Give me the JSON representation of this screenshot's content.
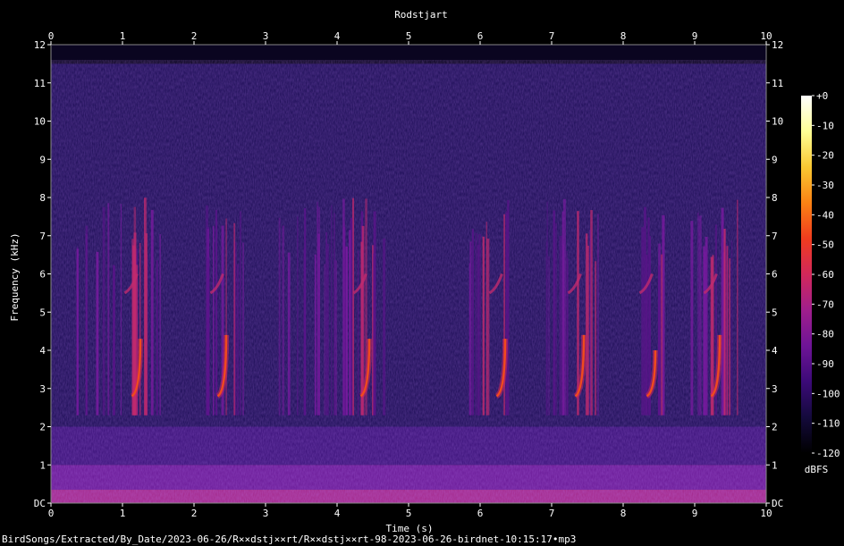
{
  "chart_data": {
    "type": "heatmap",
    "title": "Rodstjart",
    "xlabel": "Time (s)",
    "ylabel": "Frequency (kHz)",
    "xlim": [
      0,
      10
    ],
    "ylim": [
      0,
      12
    ],
    "x_ticks": [
      "0",
      "1",
      "2",
      "3",
      "4",
      "5",
      "6",
      "7",
      "8",
      "9",
      "10"
    ],
    "y_ticks": [
      "DC",
      "1",
      "2",
      "3",
      "4",
      "5",
      "6",
      "7",
      "8",
      "9",
      "10",
      "11",
      "12"
    ],
    "colorbar": {
      "label": "dBFS",
      "range": [
        -120,
        0
      ],
      "ticks": [
        "+0",
        "-10",
        "-20",
        "-30",
        "-40",
        "-50",
        "-60",
        "-70",
        "-80",
        "-90",
        "-100",
        "-110",
        "-120"
      ],
      "colors": [
        "#000000",
        "#140a3c",
        "#3c0a78",
        "#6e1496",
        "#a01e8c",
        "#d2285a",
        "#f03c1e",
        "#fa8214",
        "#fac832",
        "#ffff96",
        "#ffffff"
      ]
    },
    "song_phrases": [
      {
        "start": 0.35,
        "end": 1.55,
        "peak_start": 1.0,
        "peak_end": 1.45
      },
      {
        "start": 2.1,
        "end": 2.75,
        "peak_start": 2.3,
        "peak_end": 2.7
      },
      {
        "start": 3.1,
        "end": 4.65,
        "peak_start": 4.2,
        "peak_end": 4.65
      },
      {
        "start": 5.8,
        "end": 6.4,
        "peak_start": 6.0,
        "peak_end": 6.35
      },
      {
        "start": 6.9,
        "end": 7.7,
        "peak_start": 7.3,
        "peak_end": 7.65
      },
      {
        "start": 8.2,
        "end": 8.6,
        "peak_start": 8.3,
        "peak_end": 8.55
      },
      {
        "start": 8.85,
        "end": 9.6,
        "peak_start": 9.2,
        "peak_end": 9.6
      }
    ],
    "calls": [
      {
        "t": 1.2,
        "f_low": 2.8,
        "f_high": 4.3
      },
      {
        "t": 2.4,
        "f_low": 2.8,
        "f_high": 4.4
      },
      {
        "t": 4.4,
        "f_low": 2.8,
        "f_high": 4.3
      },
      {
        "t": 6.3,
        "f_low": 2.8,
        "f_high": 4.3
      },
      {
        "t": 7.4,
        "f_low": 2.8,
        "f_high": 4.4
      },
      {
        "t": 8.4,
        "f_low": 2.8,
        "f_high": 4.0
      },
      {
        "t": 9.3,
        "f_low": 2.8,
        "f_high": 4.4
      }
    ]
  },
  "footer": {
    "filename": "BirdSongs/Extracted/By_Date/2023-06-26/R××dstj××rt/R××dstj××rt-98-2023-06-26-birdnet-10:15:17•mp3"
  }
}
